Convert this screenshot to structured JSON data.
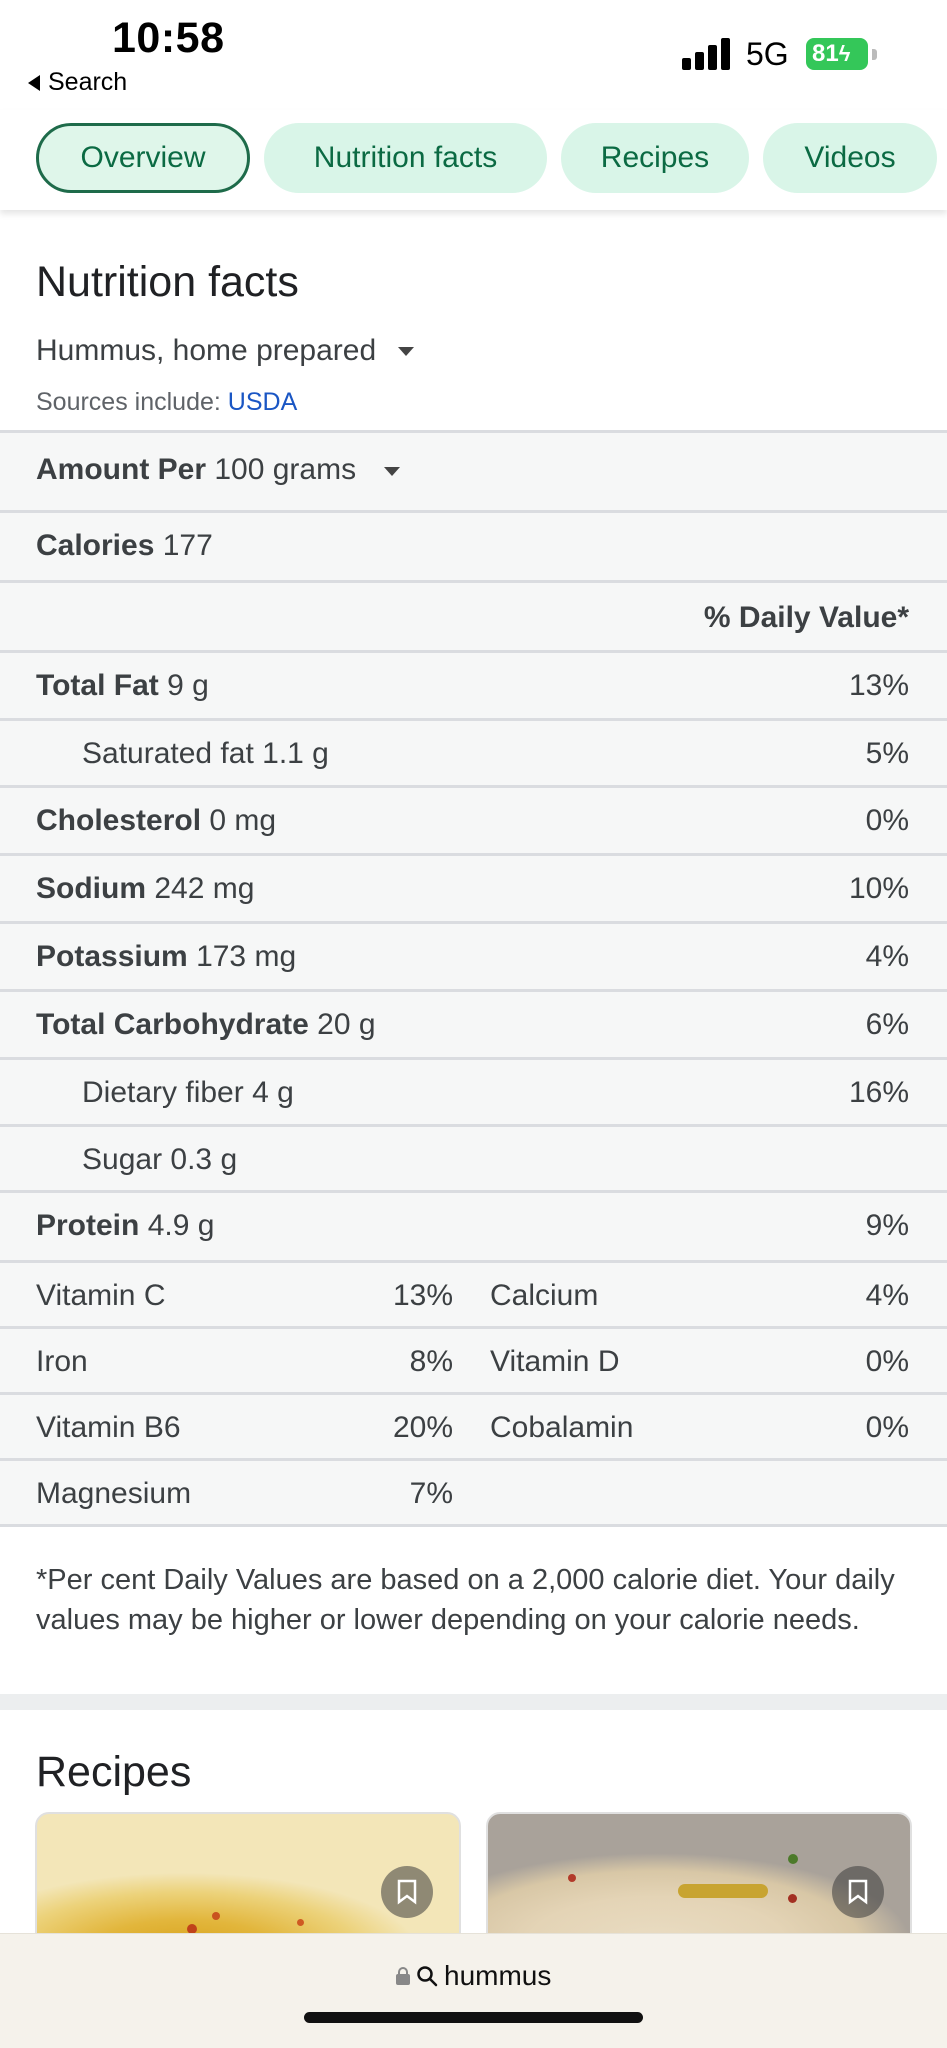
{
  "status": {
    "time": "10:58",
    "back_label": "Search",
    "network": "5G",
    "battery": "81"
  },
  "chips": [
    "Overview",
    "Nutrition facts",
    "Recipes",
    "Videos"
  ],
  "nutrition": {
    "title": "Nutrition facts",
    "food": "Hummus, home prepared",
    "sources_prefix": "Sources include:",
    "sources_link": "USDA",
    "amount_label": "Amount Per",
    "amount_value": "100 grams",
    "calories_label": "Calories",
    "calories_value": "177",
    "daily_value_header": "% Daily Value*",
    "rows": [
      {
        "label": "Total Fat",
        "amount": "9 g",
        "pct": "13%"
      },
      {
        "label": "Saturated fat",
        "amount": "1.1 g",
        "pct": "5%"
      },
      {
        "label": "Cholesterol",
        "amount": "0 mg",
        "pct": "0%"
      },
      {
        "label": "Sodium",
        "amount": "242 mg",
        "pct": "10%"
      },
      {
        "label": "Potassium",
        "amount": "173 mg",
        "pct": "4%"
      },
      {
        "label": "Total Carbohydrate",
        "amount": "20 g",
        "pct": "6%"
      },
      {
        "label": "Dietary fiber",
        "amount": "4 g",
        "pct": "16%"
      },
      {
        "label": "Sugar",
        "amount": "0.3 g",
        "pct": ""
      },
      {
        "label": "Protein",
        "amount": "4.9 g",
        "pct": "9%"
      }
    ],
    "vitamins": [
      {
        "name": "Vitamin C",
        "pct": "13%",
        "name2": "Calcium",
        "pct2": "4%"
      },
      {
        "name": "Iron",
        "pct": "8%",
        "name2": "Vitamin D",
        "pct2": "0%"
      },
      {
        "name": "Vitamin B6",
        "pct": "20%",
        "name2": "Cobalamin",
        "pct2": "0%"
      },
      {
        "name": "Magnesium",
        "pct": "7%",
        "name2": "",
        "pct2": ""
      }
    ],
    "footnote": "*Per cent Daily Values are based on a 2,000 calorie diet. Your daily values may be higher or lower depending on your calorie needs."
  },
  "recipes": {
    "title": "Recipes"
  },
  "address_bar": {
    "query": "hummus"
  },
  "colors": {
    "chip_bg": "#d9f5e8",
    "chip_text": "#0b6a43",
    "link": "#1a56c4",
    "table_bg": "#f6f7f7"
  }
}
